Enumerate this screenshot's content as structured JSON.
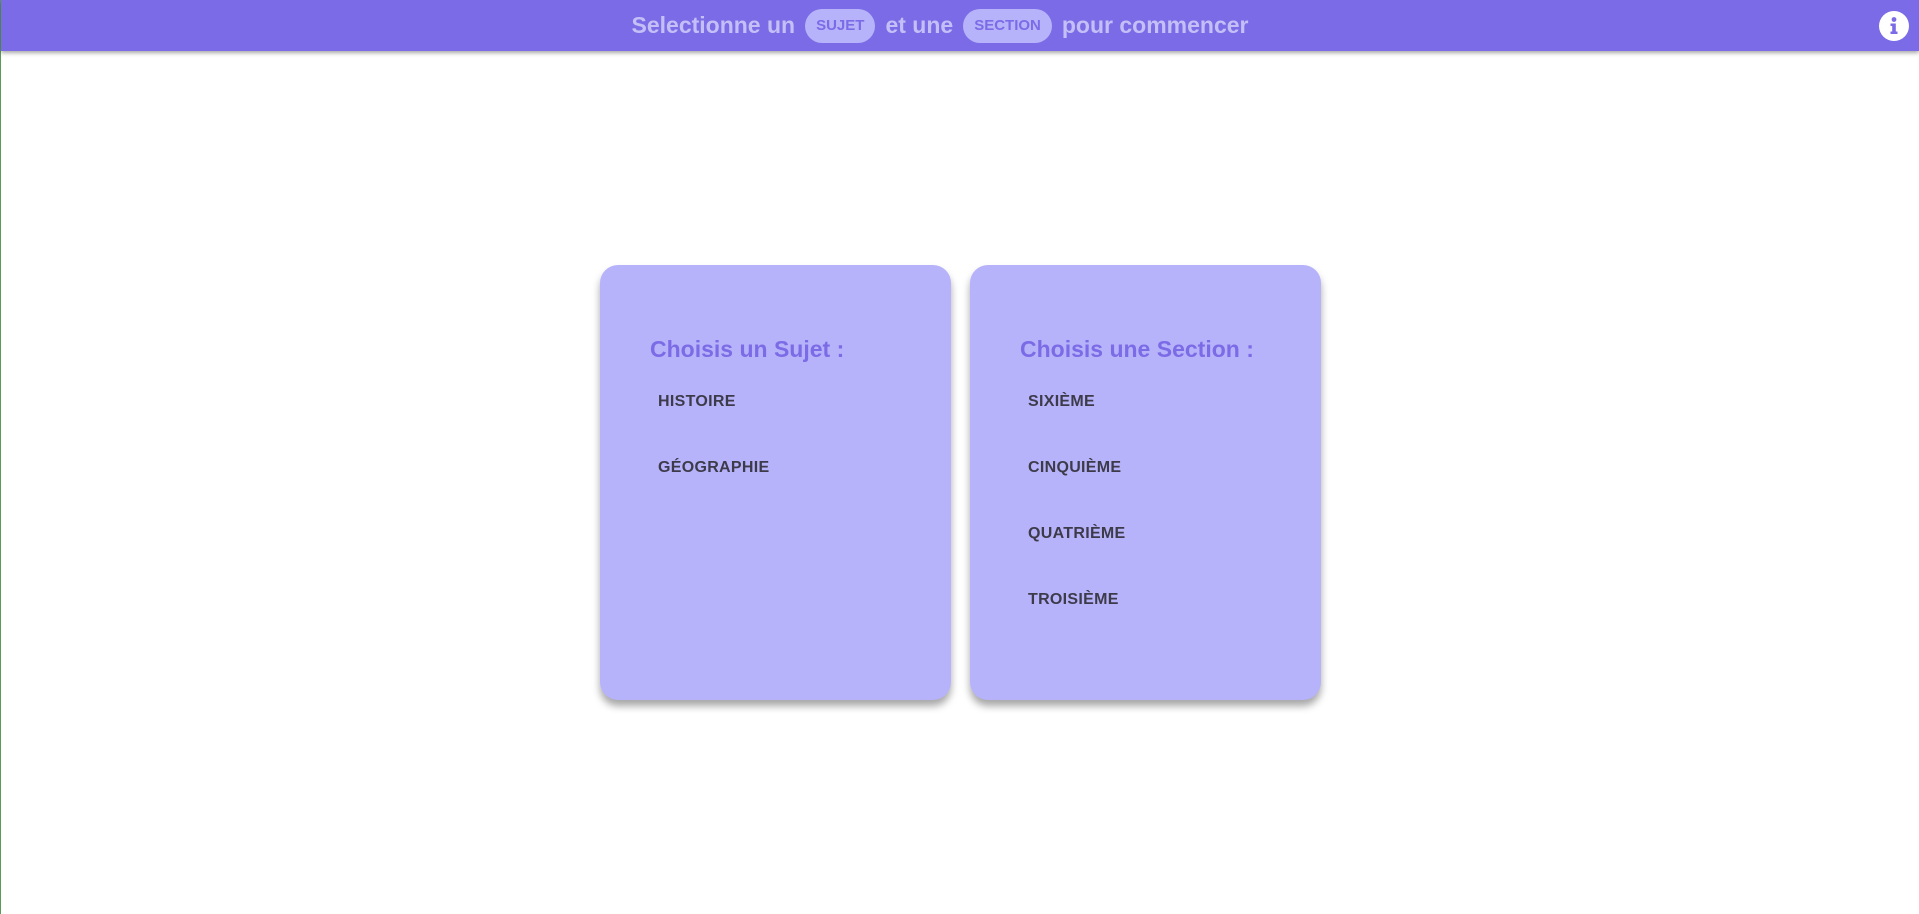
{
  "header": {
    "prefix": "Selectionne un",
    "subject_chip": "SUJET",
    "middle": "et une",
    "section_chip": "SECTION",
    "suffix": "pour commencer",
    "info_icon": "info-icon"
  },
  "subject_card": {
    "title": "Choisis un Sujet :",
    "options": [
      "HISTOIRE",
      "GÉOGRAPHIE"
    ]
  },
  "section_card": {
    "title": "Choisis une Section :",
    "options": [
      "SIXIÈME",
      "CINQUIÈME",
      "QUATRIÈME",
      "TROISIÈME"
    ]
  },
  "colors": {
    "accent": "#7b6be6",
    "card_background": "#b7b3fb",
    "header_text": "#c4c0f7",
    "option_text": "#3d3b4a"
  }
}
